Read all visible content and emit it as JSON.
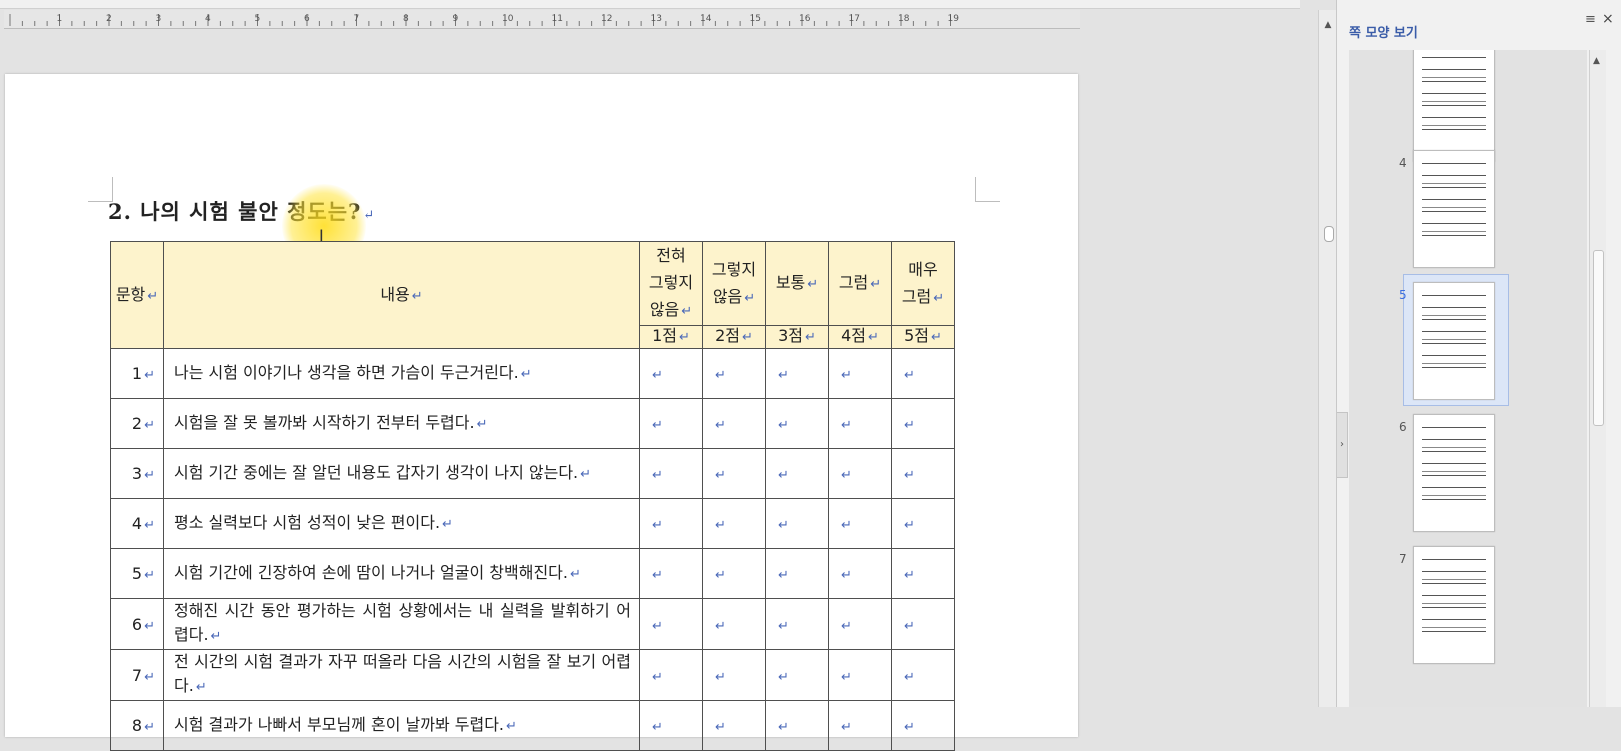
{
  "document": {
    "heading": "2. 나의 시험 불안 정도는?",
    "mark": "↵",
    "table": {
      "header": {
        "item_label": "문항",
        "content_label": "내용",
        "options": [
          {
            "label": "전혀\n그렇지\n않음",
            "score": "1점"
          },
          {
            "label": "그렇지\n않음",
            "score": "2점"
          },
          {
            "label": "보통",
            "score": "3점"
          },
          {
            "label": "그럼",
            "score": "4점"
          },
          {
            "label": "매우\n그럼",
            "score": "5점"
          }
        ]
      },
      "rows": [
        {
          "num": "1",
          "text": "나는 시험 이야기나 생각을 하면 가슴이 두근거린다."
        },
        {
          "num": "2",
          "text": "시험을 잘 못 볼까봐 시작하기 전부터 두렵다."
        },
        {
          "num": "3",
          "text": "시험 기간 중에는 잘 알던 내용도 갑자기 생각이 나지 않는다."
        },
        {
          "num": "4",
          "text": "평소 실력보다 시험 성적이 낮은 편이다."
        },
        {
          "num": "5",
          "text": "시험 기간에 긴장하여 손에 땀이 나거나 얼굴이 창백해진다."
        },
        {
          "num": "6",
          "text": "정해진 시간 동안 평가하는 시험 상황에서는 내 실력을 발휘하기 어렵다."
        },
        {
          "num": "7",
          "text": "전 시간의 시험 결과가 자꾸 떠올라 다음 시간의 시험을 잘 보기 어렵다."
        },
        {
          "num": "8",
          "text": "시험 결과가 나빠서 부모님께 혼이 날까봐 두렵다."
        }
      ]
    }
  },
  "panel": {
    "title": "쪽 모양 보기",
    "menu_icon": "≡",
    "close_icon": "×",
    "collapse_icon": "›",
    "pages": [
      {
        "num": "",
        "active": false
      },
      {
        "num": "4",
        "active": false
      },
      {
        "num": "5",
        "active": true
      },
      {
        "num": "6",
        "active": false
      },
      {
        "num": "7",
        "active": false
      }
    ]
  },
  "ruler": {
    "numbers": [
      "1",
      "2",
      "3",
      "4",
      "5",
      "6",
      "7",
      "8",
      "9",
      "10",
      "11",
      "12",
      "13",
      "14",
      "15",
      "16",
      "17",
      "18",
      "19"
    ]
  },
  "icons": {
    "scroll_up": "▲",
    "cursor": "I"
  },
  "colors": {
    "header_fill": "#fdf3cc",
    "highlight": "#ffdc14",
    "panel_title": "#3a5ca8",
    "mark": "#4a68b8"
  }
}
